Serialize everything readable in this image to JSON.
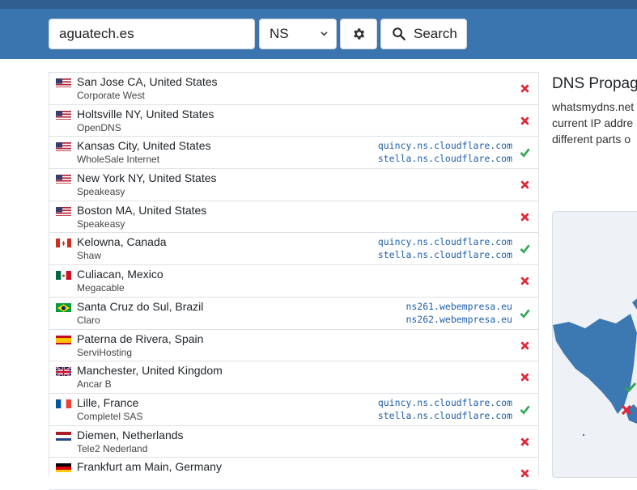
{
  "search": {
    "value": "aguatech.es"
  },
  "record_type": {
    "selected": "NS"
  },
  "buttons": {
    "search_label": "Search"
  },
  "icons": {
    "settings": "gear-icon",
    "search": "magnifier-icon",
    "select": "chevron-down-icon",
    "ok": "check-icon",
    "fail": "cross-icon"
  },
  "colors": {
    "header": "#3a75b0",
    "ok": "#2fa84f",
    "fail": "#e0263a",
    "record": "#1f5fa8"
  },
  "sidebar": {
    "title": "DNS Propag",
    "desc_lines": [
      "whatsmydns.net",
      "current IP addre",
      "different parts o"
    ]
  },
  "results": [
    {
      "flag": "us",
      "location": "San Jose CA, United States",
      "isp": "Corporate West",
      "records": [],
      "status": "fail"
    },
    {
      "flag": "us",
      "location": "Holtsville NY, United States",
      "isp": "OpenDNS",
      "records": [],
      "status": "fail"
    },
    {
      "flag": "us",
      "location": "Kansas City, United States",
      "isp": "WholeSale Internet",
      "records": [
        "quincy.ns.cloudflare.com",
        "stella.ns.cloudflare.com"
      ],
      "status": "ok"
    },
    {
      "flag": "us",
      "location": "New York NY, United States",
      "isp": "Speakeasy",
      "records": [],
      "status": "fail"
    },
    {
      "flag": "us",
      "location": "Boston MA, United States",
      "isp": "Speakeasy",
      "records": [],
      "status": "fail"
    },
    {
      "flag": "ca",
      "location": "Kelowna, Canada",
      "isp": "Shaw",
      "records": [
        "quincy.ns.cloudflare.com",
        "stella.ns.cloudflare.com"
      ],
      "status": "ok"
    },
    {
      "flag": "mx",
      "location": "Culiacan, Mexico",
      "isp": "Megacable",
      "records": [],
      "status": "fail"
    },
    {
      "flag": "br",
      "location": "Santa Cruz do Sul, Brazil",
      "isp": "Claro",
      "records": [
        "ns261.webempresa.eu",
        "ns262.webempresa.eu"
      ],
      "status": "ok"
    },
    {
      "flag": "es",
      "location": "Paterna de Rivera, Spain",
      "isp": "ServiHosting",
      "records": [],
      "status": "fail"
    },
    {
      "flag": "gb",
      "location": "Manchester, United Kingdom",
      "isp": "Ancar B",
      "records": [],
      "status": "fail"
    },
    {
      "flag": "fr",
      "location": "Lille, France",
      "isp": "Completel SAS",
      "records": [
        "quincy.ns.cloudflare.com",
        "stella.ns.cloudflare.com"
      ],
      "status": "ok"
    },
    {
      "flag": "nl",
      "location": "Diemen, Netherlands",
      "isp": "Tele2 Nederland",
      "records": [],
      "status": "fail"
    },
    {
      "flag": "de",
      "location": "Frankfurt am Main, Germany",
      "isp": "",
      "records": [],
      "status": "fail"
    }
  ]
}
